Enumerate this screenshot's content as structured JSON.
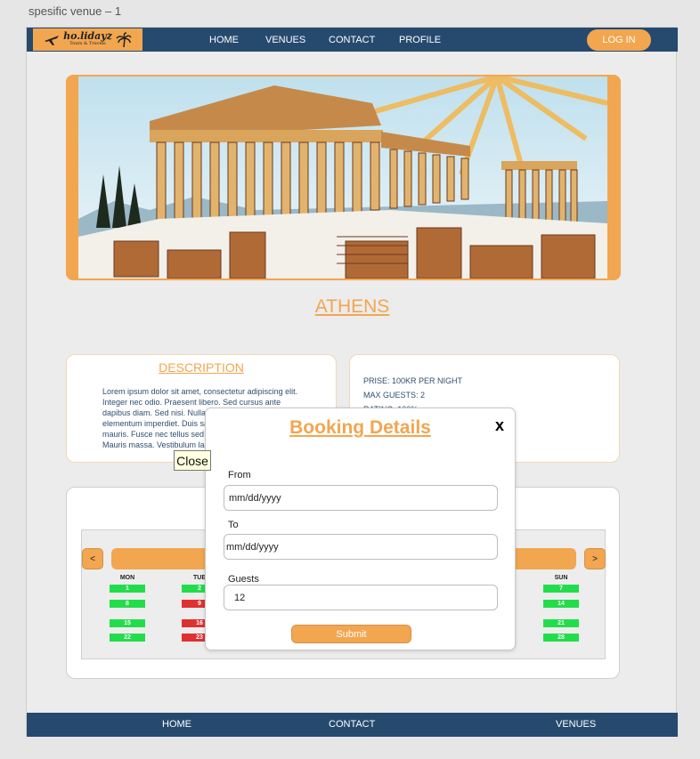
{
  "frame_label": "spesific venue – 1",
  "header": {
    "logo_text": "ho.lidayz",
    "logo_sub": "Tours & Travels",
    "nav": [
      "HOME",
      "VENUES",
      "CONTACT",
      "PROFILE"
    ],
    "login_label": "LOG IN"
  },
  "venue": {
    "title": "ATHENS",
    "description_title": "DESCRIPTION",
    "description": "Lorem ipsum dolor sit amet, consectetur adipiscing elit. Integer nec odio. Praesent libero. Sed cursus ante dapibus diam. Sed nisi. Nulla quis sem at nibh elementum imperdiet. Duis sagittis ipsum. Praesent mauris. Fusce nec tellus sed augue semper porta. Mauris massa. Vestibulum lacinia arcu eget nulla.",
    "price": "PRISE: 100KR PER NIGHT",
    "max_guests": "MAX GUESTS: 2",
    "rating": "RATING: 100%"
  },
  "calendar": {
    "prev_label": "<",
    "next_label": ">",
    "days": [
      "MON",
      "TUE",
      "SUN"
    ],
    "rows": [
      {
        "mon": "1",
        "tue": "2",
        "sun": "7",
        "tue_status": "available"
      },
      {
        "mon": "8",
        "tue": "9",
        "sun": "14",
        "tue_status": "booked"
      },
      {
        "mon": "15",
        "tue": "16",
        "sun": "21",
        "tue_status": "booked"
      },
      {
        "mon": "22",
        "tue": "23",
        "sun": "28",
        "tue_status": "booked"
      }
    ],
    "colors": {
      "available": "#22dd4a",
      "booked": "#e03030"
    }
  },
  "modal": {
    "title": "Booking Details",
    "close_label": "x",
    "from_label": "From",
    "from_value": "mm/dd/yyyy",
    "to_label": "To",
    "to_value": "mm/dd/yyyy",
    "guests_label": "Guests",
    "guests_value": "12",
    "submit_label": "Submit"
  },
  "tooltip": "Close",
  "footer": {
    "links": [
      "HOME",
      "CONTACT",
      "VENUES"
    ]
  },
  "colors": {
    "brand_orange": "#f2a650",
    "brand_navy": "#264a6e"
  }
}
